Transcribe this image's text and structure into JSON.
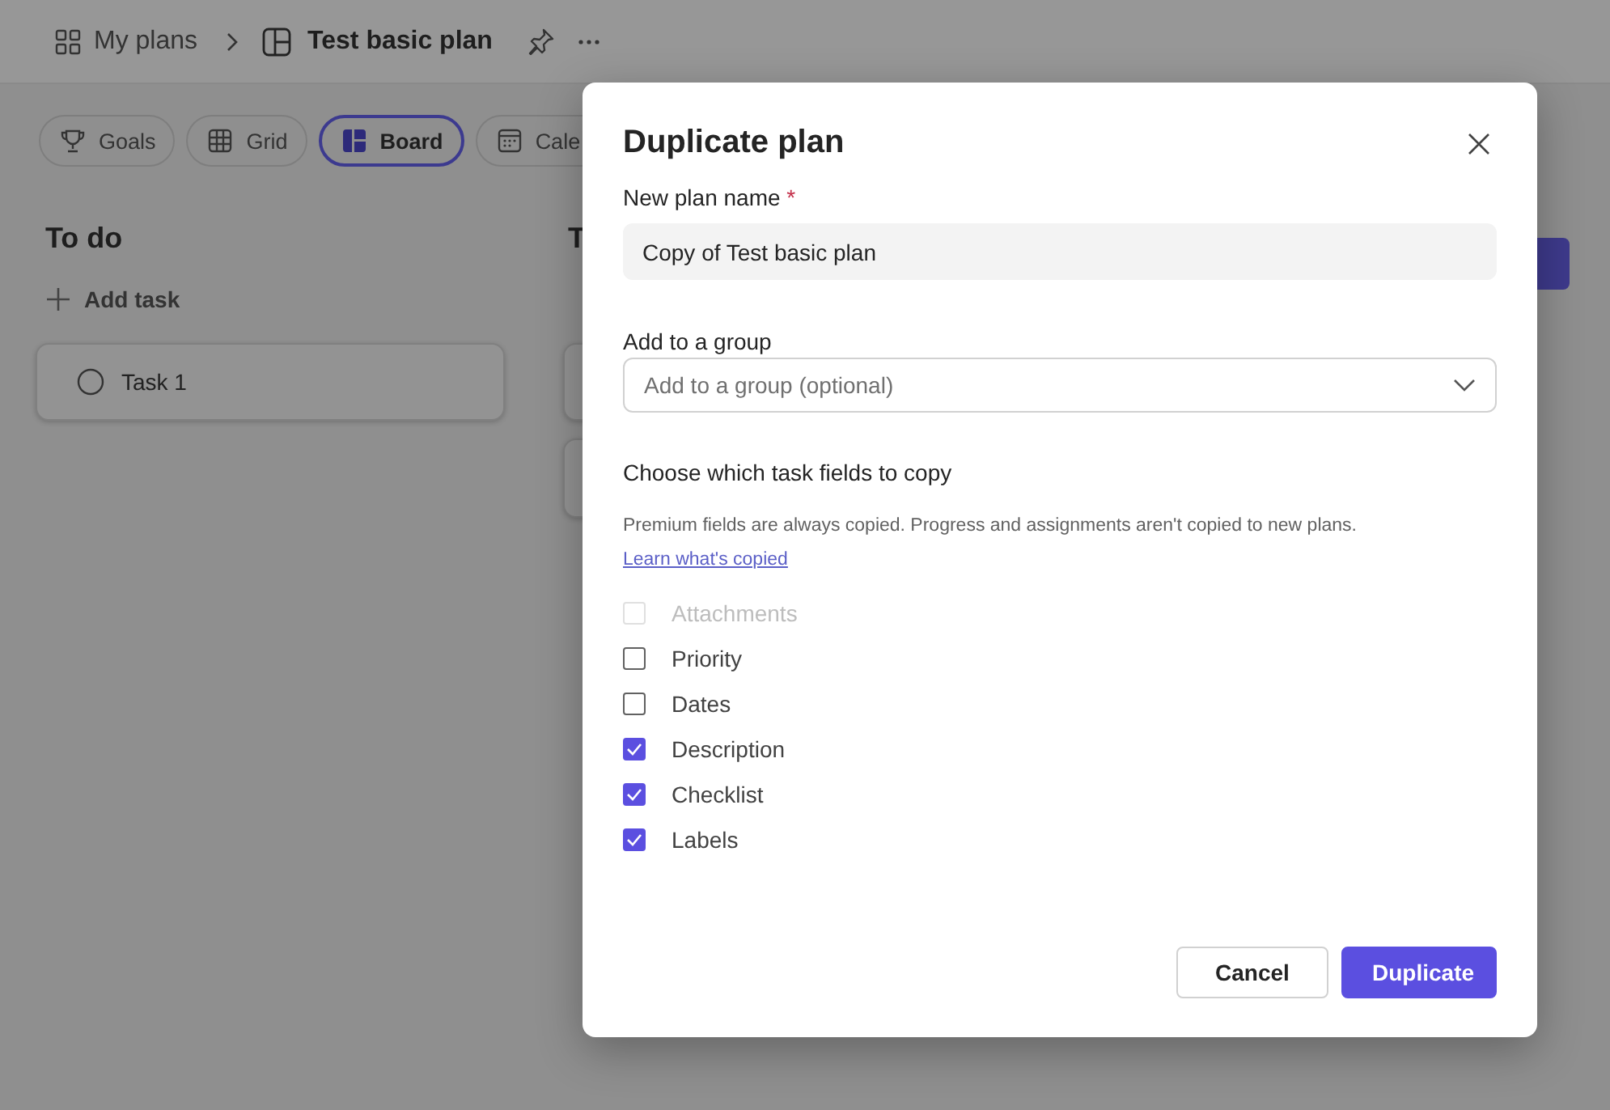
{
  "header": {
    "breadcrumb": [
      {
        "label": "My plans",
        "kind": "plans"
      },
      {
        "label": "Test basic plan",
        "kind": "plan"
      }
    ]
  },
  "view_tabs": [
    {
      "label": "Goals",
      "kind": "goals",
      "selected": false
    },
    {
      "label": "Grid",
      "kind": "grid",
      "selected": false
    },
    {
      "label": "Board",
      "kind": "board",
      "selected": true
    },
    {
      "label": "Cale",
      "kind": "calendar",
      "selected": false
    }
  ],
  "board": {
    "columns": [
      {
        "title": "To do",
        "add_label": "Add task",
        "tasks": [
          {
            "title": "Task 1"
          }
        ]
      },
      {
        "title": "T",
        "tasks": [
          {
            "kind": "blank"
          },
          {
            "kind": "blank"
          }
        ]
      }
    ]
  },
  "dialog": {
    "title": "Duplicate plan",
    "name_label": "New plan name",
    "required_mark": "*",
    "name_value": "Copy of Test basic plan",
    "group_label": "Add to a group",
    "group_placeholder": "Add to a group (optional)",
    "fields_heading": "Choose which task fields to copy",
    "note": "Premium fields are always copied. Progress and assignments aren't copied to new plans.",
    "note_link": "Learn what's copied",
    "fields": [
      {
        "label": "Attachments",
        "checked": false,
        "disabled": true
      },
      {
        "label": "Priority",
        "checked": false,
        "disabled": false
      },
      {
        "label": "Dates",
        "checked": false,
        "disabled": false
      },
      {
        "label": "Description",
        "checked": true,
        "disabled": false
      },
      {
        "label": "Checklist",
        "checked": true,
        "disabled": false
      },
      {
        "label": "Labels",
        "checked": true,
        "disabled": false
      }
    ],
    "buttons": [
      {
        "label": "Cancel",
        "kind": "secondary"
      },
      {
        "label": "Duplicate",
        "kind": "primary"
      }
    ]
  }
}
